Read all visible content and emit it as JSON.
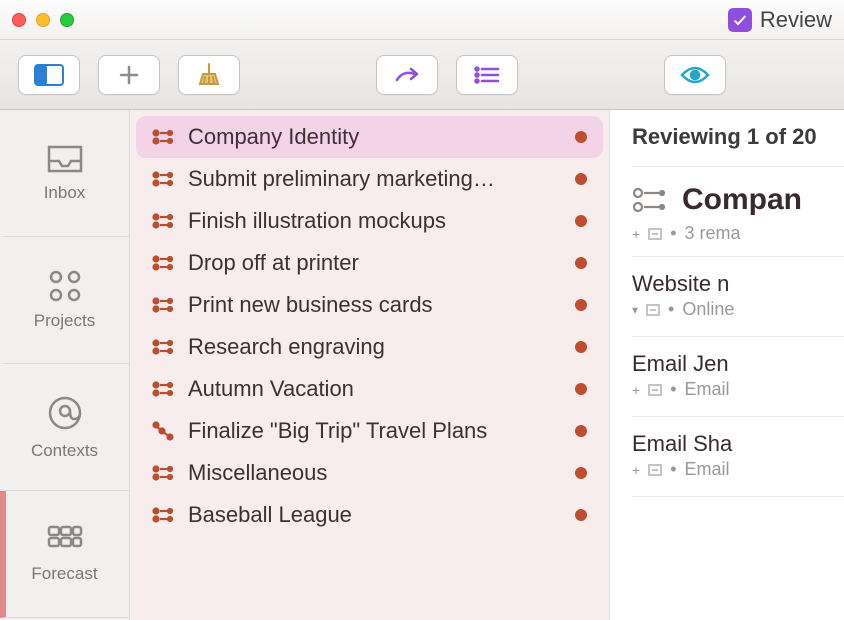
{
  "window": {
    "mode_label": "Review"
  },
  "sidebar": {
    "tabs": [
      {
        "label": "Inbox"
      },
      {
        "label": "Projects"
      },
      {
        "label": "Contexts"
      },
      {
        "label": "Forecast"
      }
    ]
  },
  "list": {
    "items": [
      {
        "label": "Company Identity",
        "selected": true,
        "type": "parallel",
        "flag": true
      },
      {
        "label": "Submit preliminary marketing…",
        "selected": false,
        "type": "parallel",
        "flag": true
      },
      {
        "label": "Finish illustration mockups",
        "selected": false,
        "type": "parallel",
        "flag": true
      },
      {
        "label": "Drop off at printer",
        "selected": false,
        "type": "parallel",
        "flag": true
      },
      {
        "label": "Print new business cards",
        "selected": false,
        "type": "parallel",
        "flag": true
      },
      {
        "label": "Research engraving",
        "selected": false,
        "type": "parallel",
        "flag": true
      },
      {
        "label": "Autumn Vacation",
        "selected": false,
        "type": "parallel",
        "flag": true
      },
      {
        "label": "Finalize \"Big Trip\" Travel Plans",
        "selected": false,
        "type": "sequential",
        "flag": true
      },
      {
        "label": "Miscellaneous",
        "selected": false,
        "type": "parallel",
        "flag": true
      },
      {
        "label": "Baseball League",
        "selected": false,
        "type": "parallel",
        "flag": true
      }
    ]
  },
  "detail": {
    "header": "Reviewing 1 of 20",
    "project_title": "Compan",
    "project_meta": "3 rema",
    "items": [
      {
        "title": "Website n",
        "meta": "Online",
        "disclosure": "expanded"
      },
      {
        "title": "Email Jen",
        "meta": "Email",
        "disclosure": "collapsed"
      },
      {
        "title": "Email Sha",
        "meta": "Email",
        "disclosure": "collapsed"
      }
    ]
  }
}
